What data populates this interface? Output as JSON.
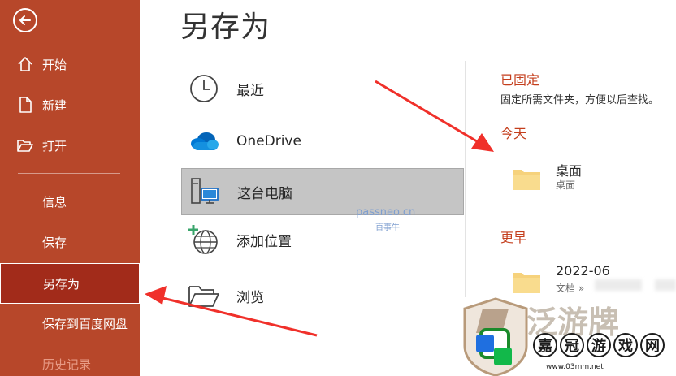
{
  "sidebar": {
    "items": [
      {
        "label": "开始",
        "icon": "home-icon"
      },
      {
        "label": "新建",
        "icon": "new-document-icon"
      },
      {
        "label": "打开",
        "icon": "open-folder-icon"
      },
      {
        "label": "信息"
      },
      {
        "label": "保存"
      },
      {
        "label": "另存为",
        "selected": true
      },
      {
        "label": "保存到百度网盘"
      },
      {
        "label": "历史记录"
      }
    ]
  },
  "main": {
    "title": "另存为",
    "locations": [
      {
        "label": "最近",
        "icon": "clock-icon"
      },
      {
        "label": "OneDrive",
        "icon": "onedrive-cloud-icon"
      },
      {
        "label": "这台电脑",
        "icon": "computer-icon",
        "selected": true
      },
      {
        "label": "添加位置",
        "icon": "add-location-globe-icon"
      },
      {
        "label": "浏览",
        "icon": "browse-folder-icon"
      }
    ]
  },
  "right_pane": {
    "pinned_heading": "已固定",
    "pinned_desc": "固定所需文件夹，方便以后查找。",
    "today_heading": "今天",
    "earlier_heading": "更早",
    "folders": [
      {
        "name": "桌面",
        "path": "桌面"
      },
      {
        "name": "2022-06",
        "path": "文档 »"
      }
    ]
  },
  "watermark": {
    "text": "passneo.cn",
    "sub": "百事牛"
  },
  "logo_overlay": {
    "characters": [
      "嘉",
      "冠",
      "游",
      "戏",
      "网"
    ],
    "url": "www.03mm.net"
  },
  "colors": {
    "sidebar_bg": "#b7472a",
    "sidebar_selected_bg": "#a22b1a",
    "accent_heading": "#c43e1c",
    "selected_location_bg": "#c5c5c5",
    "folder_yellow": "#f6d27c",
    "annotation_arrow": "#f0302a"
  }
}
